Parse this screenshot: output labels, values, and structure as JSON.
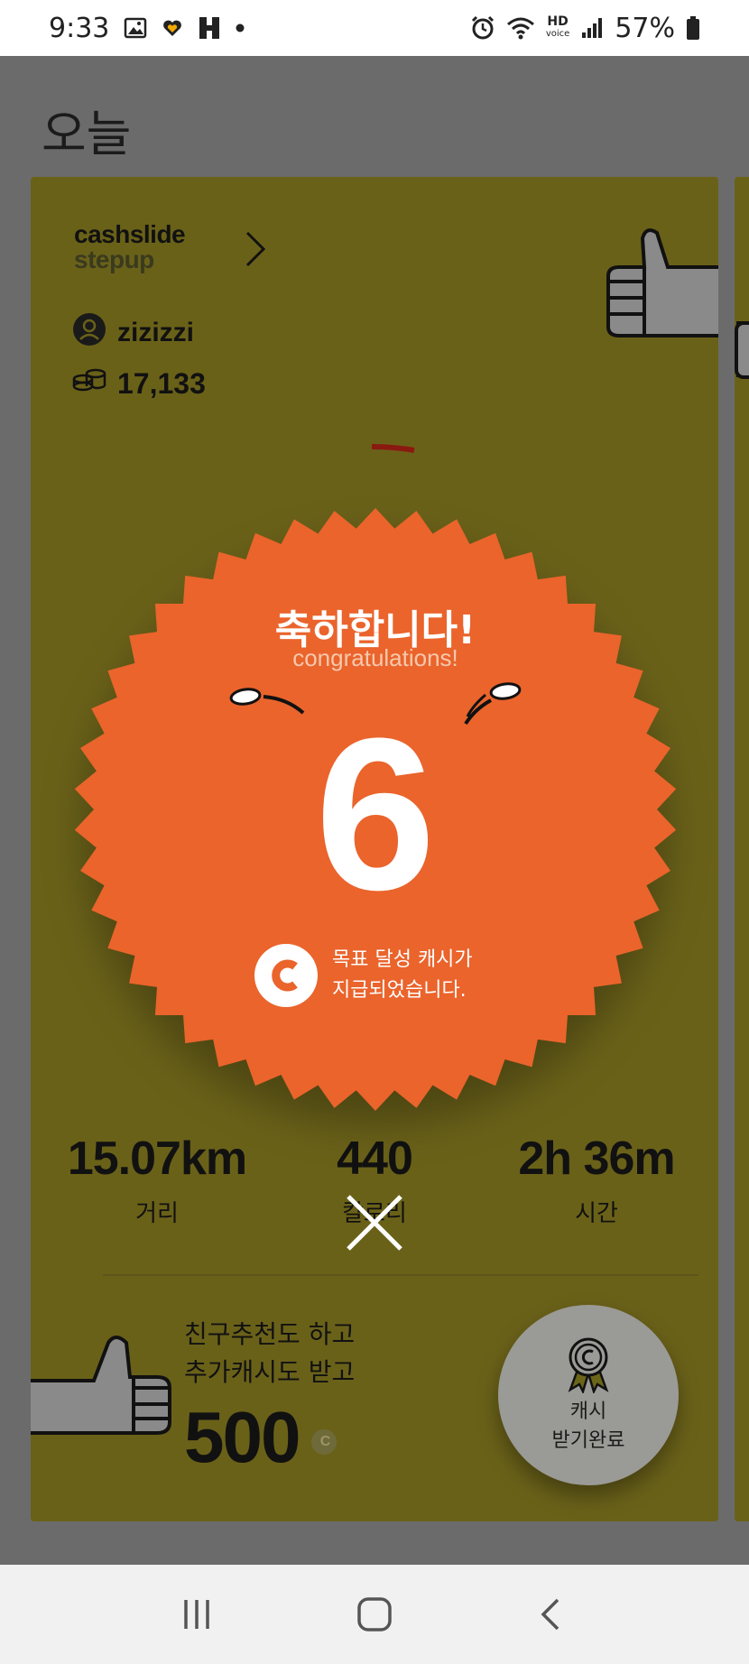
{
  "status_bar": {
    "time": "9:33",
    "battery": "57%",
    "network_label": "HD",
    "network_sub": "voice"
  },
  "page": {
    "title": "오늘"
  },
  "card": {
    "brand_line1": "cashslide",
    "brand_line2": "stepup",
    "username": "zizizzi",
    "coins": "17,133",
    "ring_progress": 0.03
  },
  "congrats": {
    "title_ko": "축하합니다!",
    "title_en": "congratulations!",
    "number": "6",
    "reward_line1": "목표 달성 캐시가",
    "reward_line2": "지급되었습니다."
  },
  "stats": {
    "distance_value": "15.07km",
    "distance_label": "거리",
    "calories_value": "440",
    "calories_label": "칼로리",
    "time_value": "2h 36m",
    "time_label": "시간"
  },
  "referral": {
    "line1": "친구추천도 하고",
    "line2": "추가캐시도 받고",
    "amount": "500",
    "coin_symbol": "C"
  },
  "claim_button": {
    "line1": "캐시",
    "line2": "받기완료"
  },
  "colors": {
    "card_bg": "#6a6119",
    "badge": "#ea642c",
    "overlay_bg": "#6b6b6b"
  },
  "icons": {
    "nav_recent": "recent-apps-icon",
    "nav_home": "home-icon",
    "nav_back": "back-icon"
  }
}
